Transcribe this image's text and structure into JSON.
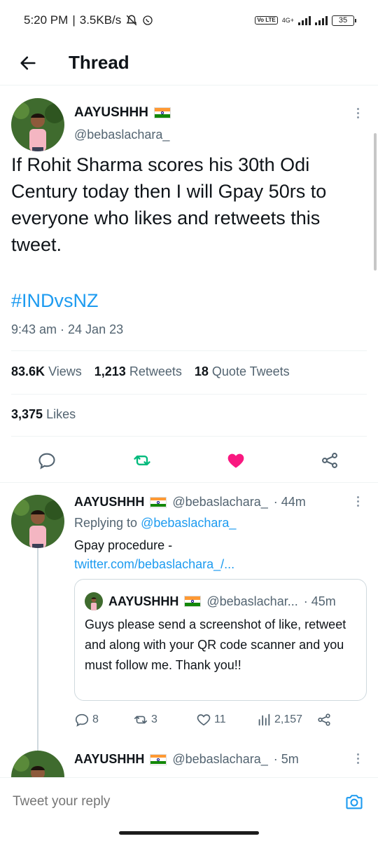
{
  "status_bar": {
    "time": "5:20 PM",
    "speed": "3.5KB/s",
    "network": "4G+",
    "volte": "Vo LTE",
    "battery": "35"
  },
  "header": {
    "title": "Thread"
  },
  "main_tweet": {
    "author_name": "AAYUSHHH",
    "author_handle": "@bebaslachara_",
    "text": "If Rohit Sharma scores his 30th Odi Century today then I will Gpay 50rs to everyone who likes and retweets this tweet.",
    "hashtag": "#INDvsNZ",
    "timestamp": "9:43 am · 24 Jan 23",
    "views_count": "83.6K",
    "views_label": "Views",
    "retweets_count": "1,213",
    "retweets_label": "Retweets",
    "quotes_count": "18",
    "quotes_label": "Quote Tweets",
    "likes_count": "3,375",
    "likes_label": "Likes"
  },
  "reply": {
    "author_name": "AAYUSHHH",
    "author_handle": "@bebaslachara_",
    "time": "· 44m",
    "replying_prefix": "Replying to",
    "replying_to": "@bebaslachara_",
    "text": "Gpay procedure -",
    "link": "twitter.com/bebaslachara_/...",
    "quote": {
      "author_name": "AAYUSHHH",
      "author_handle": "@bebaslachar...",
      "time": "· 45m",
      "text": "Guys please send a screenshot of like, retweet and along with your QR code scanner and you must follow me. Thank you!!"
    },
    "replies": "8",
    "retweets": "3",
    "likes": "11",
    "views": "2,157"
  },
  "reply2": {
    "author_name": "AAYUSHHH",
    "author_handle": "@bebaslachara_",
    "time": "· 5m"
  },
  "compose": {
    "placeholder": "Tweet your reply"
  },
  "colors": {
    "accent": "#1d9bf0",
    "like": "#f91880",
    "retweet": "#00ba7c"
  }
}
